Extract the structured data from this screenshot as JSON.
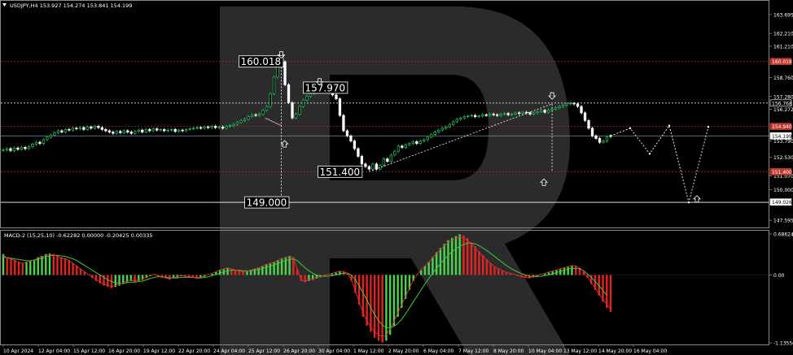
{
  "header": {
    "symbol_info": "USDJPY,H4  153.927 154.274 153.841 154.199",
    "macd_info": "MACD-2 (15,25,10) -0.62282 0.00000 -0.20425 0.00335"
  },
  "colors": {
    "background": "#000000",
    "candle_up": "#22c55e",
    "candle_down": "#ffffff",
    "grid_red": "#b22222",
    "hline_white": "#ffffff",
    "price_line": "#6c8cb0",
    "hist_up": "#4cd44c",
    "hist_down": "#e52222",
    "signal_green": "#3ec93e",
    "signal_red": "#e03030",
    "watermark": "#2b2b2b",
    "badge_red": "#c0392b"
  },
  "chart_data": {
    "type": "candlestick",
    "title": "USDJPY,H4",
    "ylim": [
      147.1,
      164.7
    ],
    "y_ticks": [
      "163.695",
      "162.210",
      "161.210",
      "158.760",
      "157.280",
      "156.272",
      "153.790",
      "152.530",
      "151.070",
      "150.000",
      "147.595"
    ],
    "price_badges": [
      {
        "label": "160.018",
        "value": 160.018,
        "color": "#c0392b"
      },
      {
        "label": "156.768",
        "value": 156.768,
        "color": "#000000",
        "border": "#ffffff"
      },
      {
        "label": "154.940",
        "value": 154.94,
        "color": "#c0392b"
      },
      {
        "label": "154.199",
        "value": 154.199,
        "color": "#ffffff",
        "border": "#ffffff",
        "text": "#000000"
      },
      {
        "label": "151.400",
        "value": 151.4,
        "color": "#c0392b"
      },
      {
        "label": "149.026",
        "value": 149.026,
        "color": "#ffffff",
        "text": "#000000"
      }
    ],
    "x_labels": [
      "10 Apr 2024",
      "12 Apr 04:00",
      "15 Apr 12:00",
      "16 Apr 20:00",
      "19 Apr 12:00",
      "22 Apr 20:00",
      "24 Apr 04:00",
      "25 Apr 12:00",
      "26 Apr 20:00",
      "30 Apr 04:00",
      "1 May 12:00",
      "2 May 20:00",
      "6 May 04:00",
      "7 May 12:00",
      "8 May 20:00",
      "10 May 04:00",
      "13 May 12:00",
      "14 May 20:00",
      "16 May 04:00"
    ],
    "levels": [
      {
        "label": "160.018",
        "value": 160.018,
        "style": "red-dotted"
      },
      {
        "label": "157.970",
        "value": 157.97,
        "style": "label-only"
      },
      {
        "label": "156.768",
        "value": 156.768,
        "style": "white-dotted"
      },
      {
        "label": "154.940",
        "value": 154.94,
        "style": "red-dotted"
      },
      {
        "label": "154.199",
        "value": 154.199,
        "style": "price-line"
      },
      {
        "label": "151.400",
        "value": 151.4,
        "style": "red-dotted"
      },
      {
        "label": "149.000",
        "value": 149.0,
        "style": "white-solid"
      }
    ],
    "closes": [
      153.1,
      153.2,
      153.05,
      153.25,
      153.15,
      153.3,
      153.2,
      153.35,
      153.55,
      153.7,
      153.6,
      153.9,
      154.1,
      154.25,
      154.45,
      154.6,
      154.5,
      154.7,
      154.65,
      154.8,
      154.75,
      154.85,
      154.7,
      154.9,
      154.8,
      154.95,
      154.85,
      154.7,
      154.6,
      154.5,
      154.4,
      154.55,
      154.45,
      154.6,
      154.5,
      154.4,
      154.55,
      154.65,
      154.5,
      154.7,
      154.6,
      154.75,
      154.65,
      154.7,
      154.6,
      154.65,
      154.7,
      154.55,
      154.65,
      154.6,
      154.7,
      154.75,
      154.8,
      154.85,
      154.8,
      154.9,
      154.85,
      154.95,
      154.85,
      154.9,
      154.8,
      154.95,
      155.0,
      155.1,
      155.25,
      155.4,
      155.5,
      155.7,
      155.85,
      155.8,
      155.9,
      156.2,
      156.5,
      157.5,
      158.8,
      159.6,
      160.0,
      158.2,
      156.8,
      155.6,
      155.9,
      156.5,
      157.0,
      157.3,
      157.5,
      157.6,
      157.8,
      157.9,
      157.7,
      157.85,
      157.4,
      157.1,
      155.8,
      154.6,
      154.2,
      153.8,
      153.2,
      152.6,
      152.0,
      151.8,
      151.6,
      152.0,
      151.6,
      151.9,
      152.4,
      152.2,
      152.7,
      153.0,
      153.4,
      153.3,
      153.5,
      153.6,
      153.75,
      153.6,
      153.8,
      153.9,
      154.1,
      154.3,
      154.5,
      154.65,
      154.8,
      154.9,
      155.1,
      155.3,
      155.5,
      155.6,
      155.7,
      155.75,
      155.8,
      155.7,
      155.75,
      155.85,
      155.8,
      155.9,
      155.85,
      155.8,
      155.9,
      155.95,
      155.85,
      155.9,
      156.0,
      155.95,
      156.05,
      156.0,
      155.9,
      156.0,
      156.1,
      156.2,
      156.05,
      156.2,
      156.3,
      156.4,
      156.5,
      156.6,
      156.7,
      156.75,
      156.7,
      156.5,
      156.0,
      155.4,
      154.8,
      154.2,
      154.0,
      153.7,
      153.8,
      154.1,
      154.2
    ],
    "forecast_path": [
      {
        "x": "16 May 04:00+1",
        "y": 154.2
      },
      {
        "x": "+2",
        "y": 154.8
      },
      {
        "x": "+3",
        "y": 152.8
      },
      {
        "x": "+4",
        "y": 155.0
      },
      {
        "x": "+5",
        "y": 149.0
      },
      {
        "x": "+6",
        "y": 154.9
      }
    ],
    "annotations": [
      {
        "text": "160.018",
        "kind": "price-label"
      },
      {
        "text": "157.970",
        "kind": "price-label"
      },
      {
        "text": "151.400",
        "kind": "price-label"
      },
      {
        "text": "149.000",
        "kind": "price-label"
      }
    ],
    "macd": {
      "ylim": [
        -1.1355,
        0.6862
      ],
      "y_ticks": [
        "0.68624",
        "0.00",
        "-1.13556"
      ],
      "histogram": [
        0.35,
        0.3,
        0.28,
        0.25,
        0.22,
        0.2,
        0.22,
        0.24,
        0.26,
        0.3,
        0.32,
        0.35,
        0.36,
        0.35,
        0.33,
        0.3,
        0.28,
        0.25,
        0.2,
        0.15,
        0.1,
        0.05,
        0.0,
        -0.05,
        -0.1,
        -0.14,
        -0.18,
        -0.2,
        -0.22,
        -0.2,
        -0.18,
        -0.15,
        -0.12,
        -0.1,
        -0.12,
        -0.1,
        -0.08,
        -0.05,
        -0.02,
        0.0,
        -0.02,
        -0.05,
        -0.06,
        -0.08,
        -0.06,
        -0.04,
        -0.02,
        -0.03,
        -0.04,
        -0.05,
        -0.06,
        -0.05,
        -0.03,
        0.0,
        0.02,
        0.05,
        0.08,
        0.1,
        0.12,
        0.1,
        0.08,
        0.06,
        0.05,
        0.06,
        0.08,
        0.1,
        0.12,
        0.15,
        0.18,
        0.2,
        0.22,
        0.25,
        0.28,
        0.3,
        0.32,
        0.3,
        0.1,
        -0.1,
        -0.12,
        -0.1,
        -0.08,
        -0.06,
        -0.04,
        -0.02,
        0.0,
        0.02,
        0.04,
        0.06,
        0.05,
        0.02,
        -0.1,
        -0.3,
        -0.5,
        -0.7,
        -0.85,
        -0.95,
        -1.05,
        -1.1,
        -1.13,
        -1.1,
        -1.0,
        -0.85,
        -0.7,
        -0.55,
        -0.4,
        -0.25,
        -0.1,
        0.0,
        0.08,
        0.15,
        0.22,
        0.3,
        0.38,
        0.45,
        0.52,
        0.58,
        0.62,
        0.65,
        0.68,
        0.66,
        0.62,
        0.55,
        0.48,
        0.4,
        0.33,
        0.26,
        0.2,
        0.14,
        0.1,
        0.07,
        0.04,
        0.02,
        0.0,
        -0.02,
        -0.04,
        -0.05,
        -0.06,
        -0.04,
        -0.02,
        0.0,
        0.02,
        0.04,
        0.06,
        0.08,
        0.1,
        0.12,
        0.14,
        0.16,
        0.15,
        0.12,
        0.05,
        -0.05,
        -0.15,
        -0.25,
        -0.35,
        -0.45,
        -0.55,
        -0.62
      ],
      "signal": [
        0.3,
        0.29,
        0.28,
        0.27,
        0.26,
        0.25,
        0.24,
        0.24,
        0.25,
        0.26,
        0.28,
        0.3,
        0.32,
        0.33,
        0.33,
        0.32,
        0.31,
        0.29,
        0.27,
        0.24,
        0.2,
        0.16,
        0.12,
        0.08,
        0.04,
        0.0,
        -0.04,
        -0.08,
        -0.11,
        -0.13,
        -0.14,
        -0.14,
        -0.13,
        -0.12,
        -0.12,
        -0.11,
        -0.1,
        -0.08,
        -0.06,
        -0.04,
        -0.03,
        -0.03,
        -0.04,
        -0.05,
        -0.05,
        -0.05,
        -0.04,
        -0.04,
        -0.04,
        -0.04,
        -0.05,
        -0.05,
        -0.04,
        -0.03,
        -0.01,
        0.01,
        0.03,
        0.05,
        0.07,
        0.08,
        0.08,
        0.08,
        0.07,
        0.07,
        0.07,
        0.08,
        0.09,
        0.11,
        0.13,
        0.15,
        0.17,
        0.19,
        0.22,
        0.24,
        0.26,
        0.27,
        0.24,
        0.18,
        0.12,
        0.07,
        0.03,
        0.0,
        -0.02,
        -0.02,
        -0.02,
        -0.01,
        0.0,
        0.02,
        0.03,
        0.03,
        0.0,
        -0.08,
        -0.18,
        -0.3,
        -0.42,
        -0.55,
        -0.66,
        -0.76,
        -0.84,
        -0.88,
        -0.89,
        -0.86,
        -0.81,
        -0.74,
        -0.65,
        -0.55,
        -0.45,
        -0.35,
        -0.25,
        -0.15,
        -0.06,
        0.03,
        0.11,
        0.19,
        0.26,
        0.33,
        0.39,
        0.44,
        0.48,
        0.51,
        0.53,
        0.53,
        0.52,
        0.49,
        0.45,
        0.41,
        0.36,
        0.31,
        0.26,
        0.21,
        0.16,
        0.12,
        0.08,
        0.05,
        0.02,
        0.0,
        -0.02,
        -0.03,
        -0.03,
        -0.02,
        -0.01,
        0.0,
        0.02,
        0.04,
        0.06,
        0.08,
        0.1,
        0.11,
        0.11,
        0.1,
        0.07,
        0.02,
        -0.04,
        -0.11,
        -0.18,
        -0.26,
        -0.34
      ]
    }
  },
  "watermark": {
    "text": "R"
  }
}
